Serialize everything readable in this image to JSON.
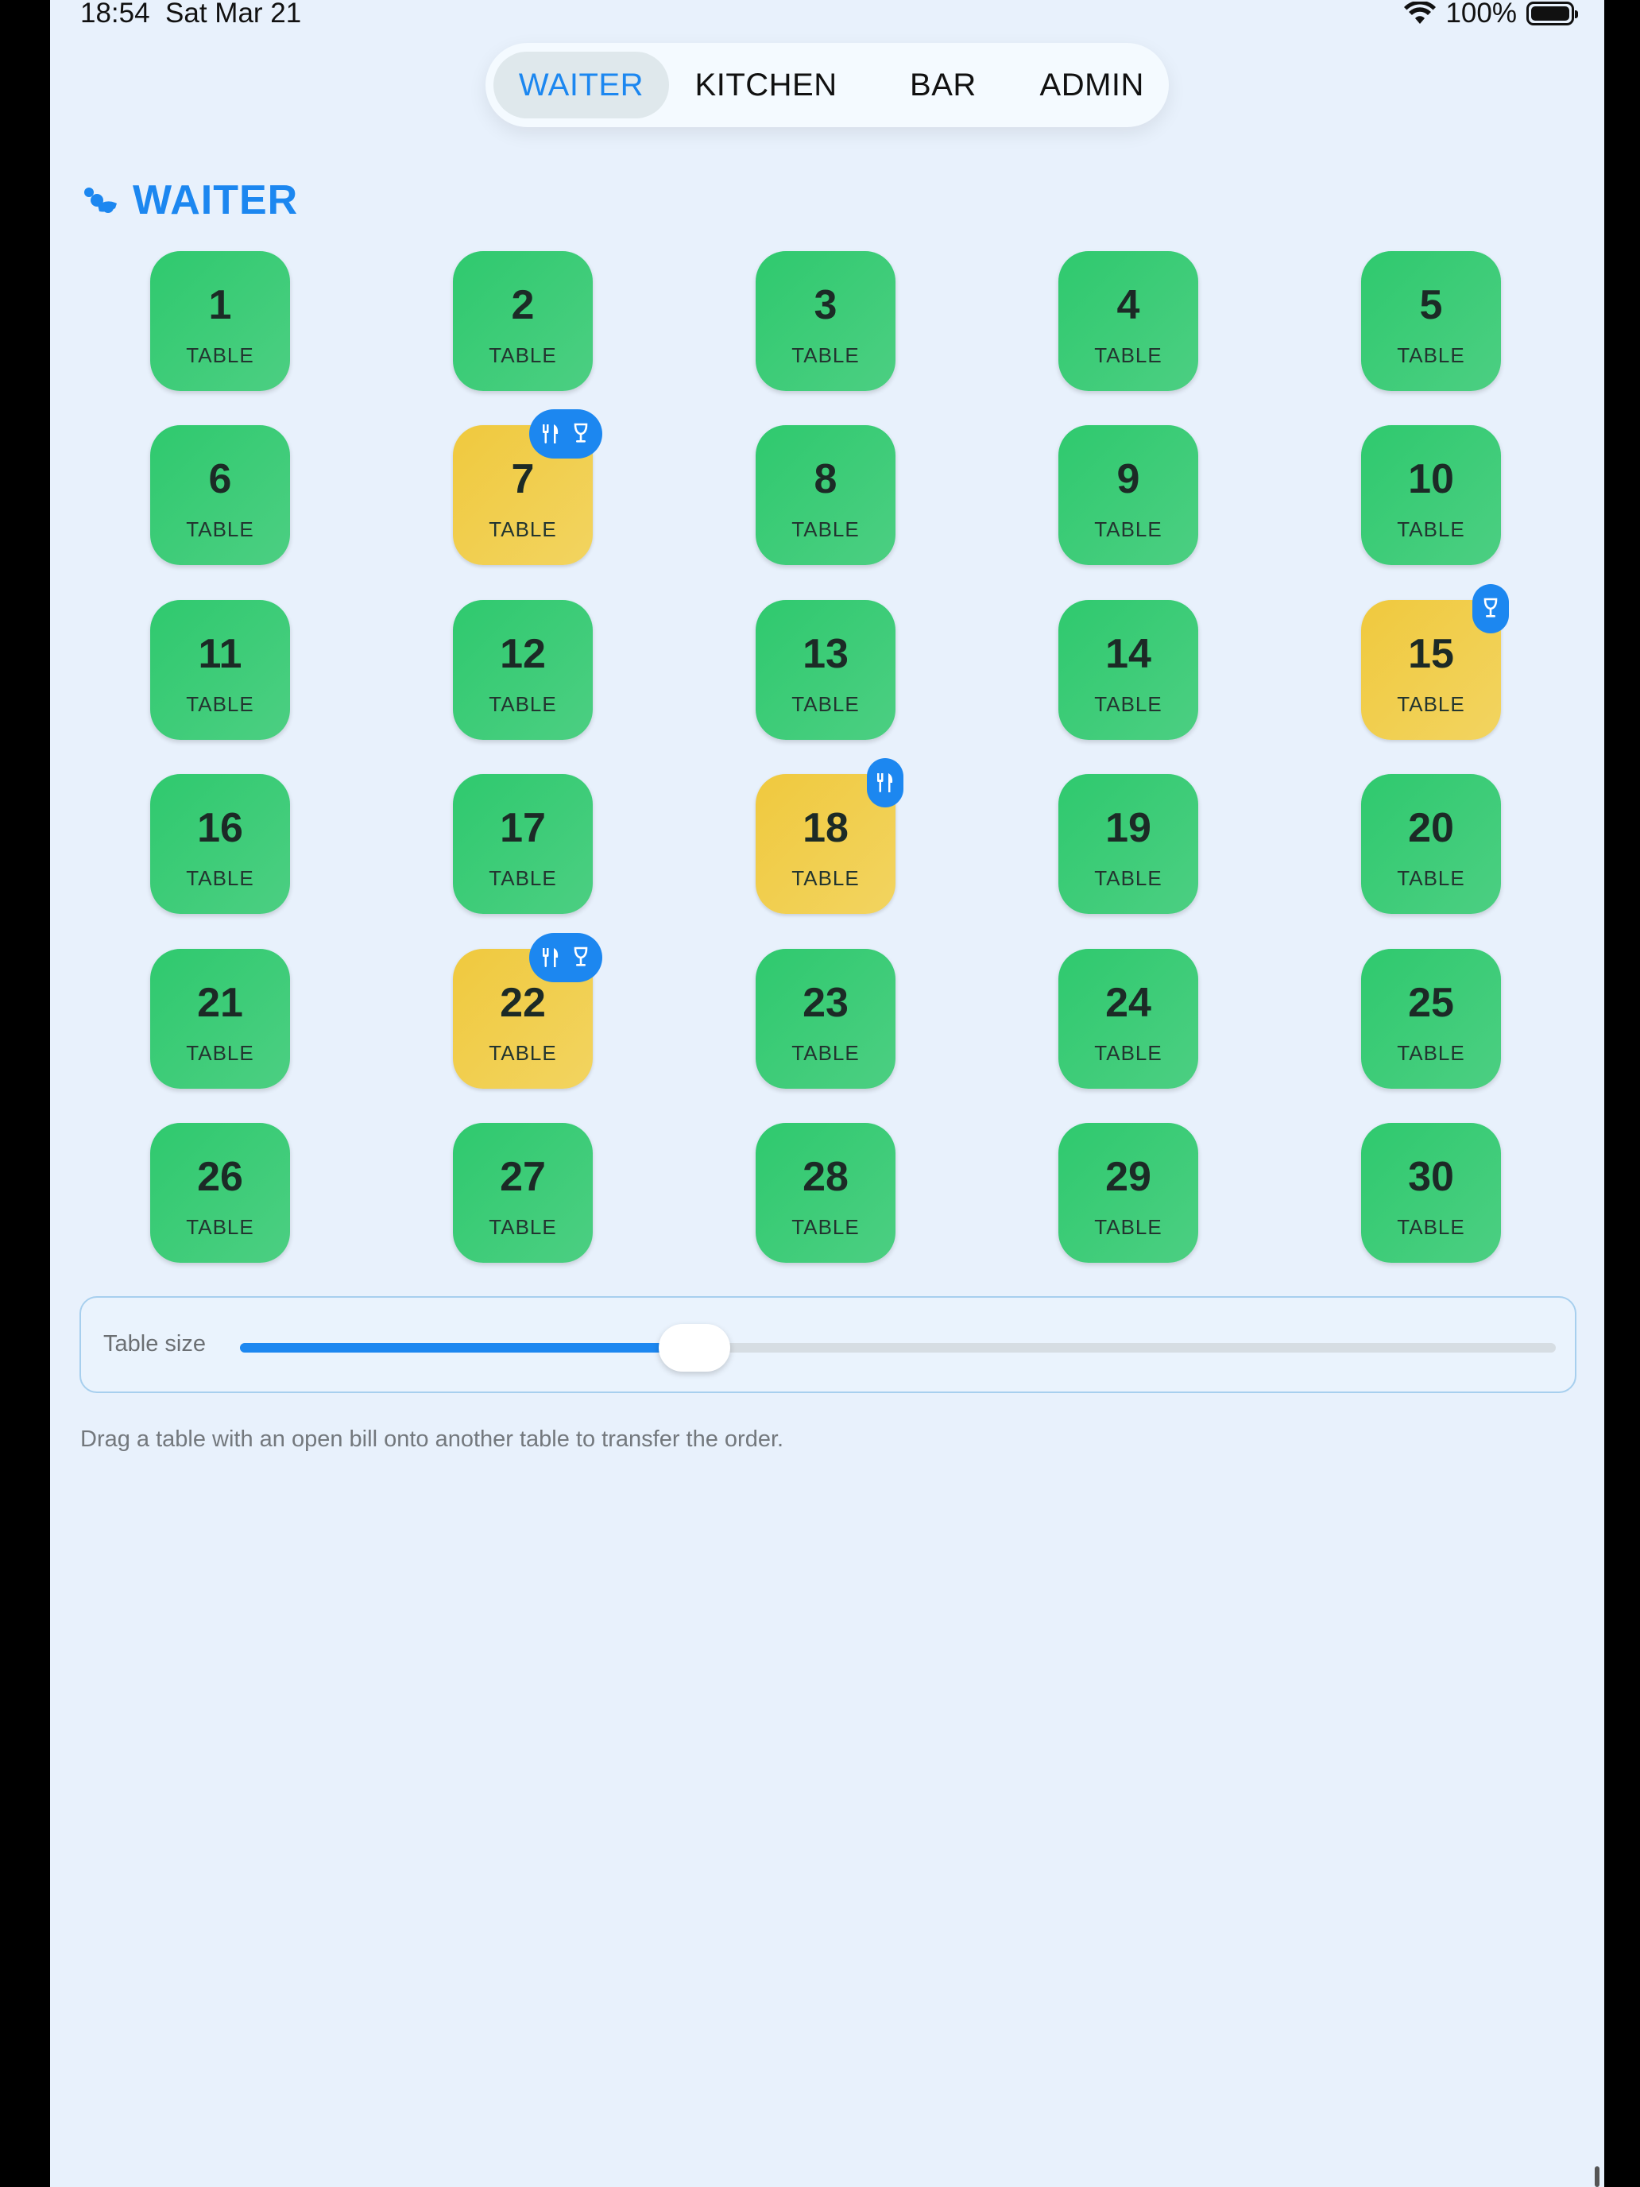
{
  "status_bar": {
    "time": "18:54",
    "date": "Sat Mar 21",
    "battery": "100%"
  },
  "nav": {
    "tabs": [
      {
        "label": "WAITER",
        "active": true
      },
      {
        "label": "KITCHEN",
        "active": false
      },
      {
        "label": "BAR",
        "active": false
      },
      {
        "label": "ADMIN",
        "active": false
      }
    ]
  },
  "header": {
    "icon": "waiter-icon",
    "title": "WAITER"
  },
  "tables": [
    {
      "num": "1",
      "label": "TABLE",
      "status": "free"
    },
    {
      "num": "2",
      "label": "TABLE",
      "status": "free"
    },
    {
      "num": "3",
      "label": "TABLE",
      "status": "free"
    },
    {
      "num": "4",
      "label": "TABLE",
      "status": "free"
    },
    {
      "num": "5",
      "label": "TABLE",
      "status": "free"
    },
    {
      "num": "6",
      "label": "TABLE",
      "status": "free"
    },
    {
      "num": "7",
      "label": "TABLE",
      "status": "open",
      "badges": [
        "food-icon",
        "drink-icon"
      ]
    },
    {
      "num": "8",
      "label": "TABLE",
      "status": "free"
    },
    {
      "num": "9",
      "label": "TABLE",
      "status": "free"
    },
    {
      "num": "10",
      "label": "TABLE",
      "status": "free"
    },
    {
      "num": "11",
      "label": "TABLE",
      "status": "free"
    },
    {
      "num": "12",
      "label": "TABLE",
      "status": "free"
    },
    {
      "num": "13",
      "label": "TABLE",
      "status": "free"
    },
    {
      "num": "14",
      "label": "TABLE",
      "status": "free"
    },
    {
      "num": "15",
      "label": "TABLE",
      "status": "open",
      "badges": [
        "drink-icon"
      ]
    },
    {
      "num": "16",
      "label": "TABLE",
      "status": "free"
    },
    {
      "num": "17",
      "label": "TABLE",
      "status": "free"
    },
    {
      "num": "18",
      "label": "TABLE",
      "status": "open",
      "badges": [
        "food-icon"
      ]
    },
    {
      "num": "19",
      "label": "TABLE",
      "status": "free"
    },
    {
      "num": "20",
      "label": "TABLE",
      "status": "free"
    },
    {
      "num": "21",
      "label": "TABLE",
      "status": "free"
    },
    {
      "num": "22",
      "label": "TABLE",
      "status": "open",
      "badges": [
        "food-icon",
        "drink-icon"
      ]
    },
    {
      "num": "23",
      "label": "TABLE",
      "status": "free"
    },
    {
      "num": "24",
      "label": "TABLE",
      "status": "free"
    },
    {
      "num": "25",
      "label": "TABLE",
      "status": "free"
    },
    {
      "num": "26",
      "label": "TABLE",
      "status": "free"
    },
    {
      "num": "27",
      "label": "TABLE",
      "status": "free"
    },
    {
      "num": "28",
      "label": "TABLE",
      "status": "free"
    },
    {
      "num": "29",
      "label": "TABLE",
      "status": "free"
    },
    {
      "num": "30",
      "label": "TABLE",
      "status": "free"
    }
  ],
  "slider": {
    "label": "Table size",
    "value_fraction": 0.34
  },
  "hint": "Drag a table with an open bill onto another table to transfer the order.",
  "colors": {
    "accent": "#1c87f0",
    "free": "#2fc96e",
    "open": "#f0c93e",
    "background": "#e8f1fc"
  }
}
